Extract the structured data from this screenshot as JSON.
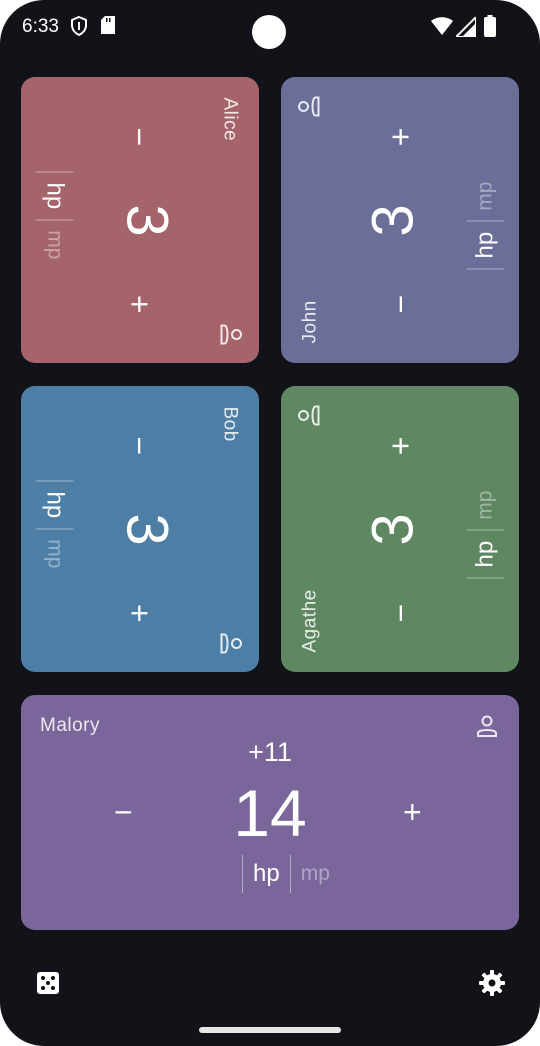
{
  "status_bar": {
    "time": "6:33"
  },
  "players": [
    {
      "name": "Alice",
      "value": "3",
      "active_mode": "hp",
      "inactive_mode": "mp",
      "color": "#A5646A",
      "orientation": "cw"
    },
    {
      "name": "John",
      "value": "3",
      "active_mode": "hp",
      "inactive_mode": "mp",
      "color": "#6A6E98",
      "orientation": "ccw"
    },
    {
      "name": "Bob",
      "value": "3",
      "active_mode": "hp",
      "inactive_mode": "mp",
      "color": "#4C7EA6",
      "orientation": "cw"
    },
    {
      "name": "Agathe",
      "value": "3",
      "active_mode": "hp",
      "inactive_mode": "mp",
      "color": "#5F8862",
      "orientation": "ccw"
    }
  ],
  "malory": {
    "name": "Malory",
    "delta": "+11",
    "value": "14",
    "active_mode": "hp",
    "inactive_mode": "mp",
    "color": "#7A669A"
  },
  "controls": {
    "minus": "−",
    "plus": "+"
  },
  "icons": {
    "person": "person-icon",
    "dice": "dice-icon",
    "settings": "gear-icon",
    "shield": "shield-icon",
    "sd": "sd-card-icon",
    "wifi": "wifi-icon",
    "signal": "signal-icon",
    "battery": "battery-icon"
  }
}
